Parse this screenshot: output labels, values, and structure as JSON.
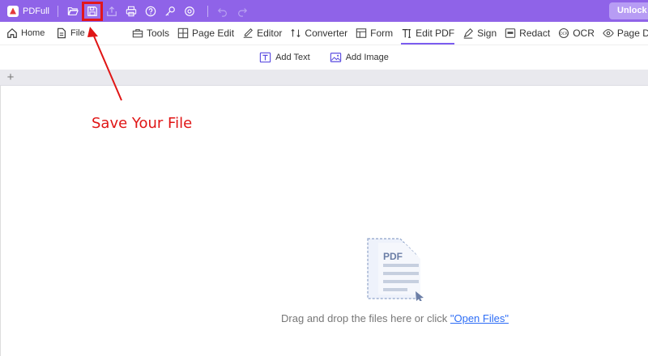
{
  "titlebar": {
    "app_name": "PDFull",
    "quick_actions": [
      "folder-open-icon",
      "save-icon",
      "export-icon",
      "print-icon",
      "help-icon",
      "key-icon",
      "settings-icon",
      "undo-icon",
      "redo-icon"
    ],
    "unlock_label": "Unlock F",
    "bg_color": "#8f63e8"
  },
  "menubar": {
    "home": "Home",
    "file": "File",
    "tools": [
      {
        "label": "Tools",
        "icon": "toolbox-icon"
      },
      {
        "label": "Page Edit",
        "icon": "page-edit-icon"
      },
      {
        "label": "Editor",
        "icon": "editor-icon"
      },
      {
        "label": "Converter",
        "icon": "converter-icon"
      },
      {
        "label": "Form",
        "icon": "form-icon"
      },
      {
        "label": "Edit PDF",
        "icon": "text-cursor-icon",
        "active": true
      },
      {
        "label": "Sign",
        "icon": "sign-icon"
      },
      {
        "label": "Redact",
        "icon": "redact-icon"
      },
      {
        "label": "OCR",
        "icon": "ocr-icon"
      },
      {
        "label": "Page Display",
        "icon": "eye-icon"
      }
    ]
  },
  "subbar": {
    "add_text": "Add Text",
    "add_image": "Add Image"
  },
  "annotation": {
    "label": "Save Your File",
    "color": "#e01515"
  },
  "dropzone": {
    "file_badge": "PDF",
    "text": "Drag and drop the files here or click ",
    "link": "\"Open Files\""
  }
}
